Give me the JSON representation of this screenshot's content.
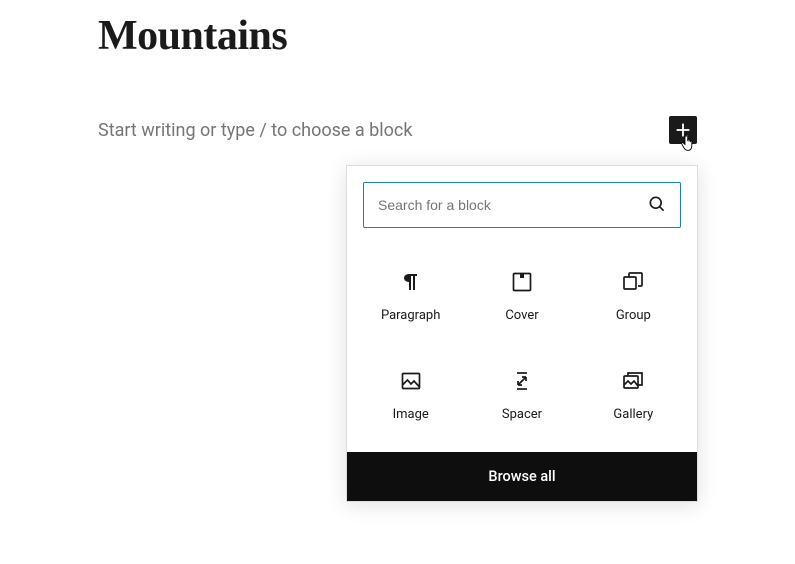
{
  "editor": {
    "title": "Mountains",
    "placeholder": "Start writing or type / to choose a block"
  },
  "inserter": {
    "search_placeholder": "Search for a block",
    "browse_all_label": "Browse all",
    "blocks": [
      {
        "label": "Paragraph",
        "icon": "paragraph-icon"
      },
      {
        "label": "Cover",
        "icon": "cover-icon"
      },
      {
        "label": "Group",
        "icon": "group-icon"
      },
      {
        "label": "Image",
        "icon": "image-icon"
      },
      {
        "label": "Spacer",
        "icon": "spacer-icon"
      },
      {
        "label": "Gallery",
        "icon": "gallery-icon"
      }
    ]
  }
}
